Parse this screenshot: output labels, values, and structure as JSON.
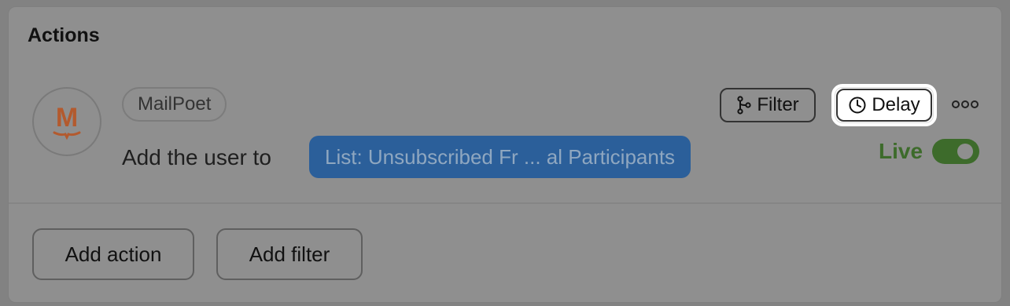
{
  "panel": {
    "title": "Actions"
  },
  "action": {
    "integration_tag": "MailPoet",
    "logo_letter": "M",
    "description": "Add the user to",
    "list_chip": "List: Unsubscribed Fr ... al Participants",
    "buttons": {
      "filter": "Filter",
      "delay": "Delay"
    },
    "status_label": "Live",
    "status_on": true
  },
  "footer": {
    "add_action": "Add action",
    "add_filter": "Add filter"
  },
  "colors": {
    "logo_accent": "#b35a2e",
    "live_green": "#3d6b2b",
    "chip_blue": "#2b5f9a"
  },
  "icons": {
    "logo": "mailpoet-logo-icon",
    "filter": "branch-icon",
    "delay": "clock-icon",
    "more": "more-dots-icon"
  }
}
